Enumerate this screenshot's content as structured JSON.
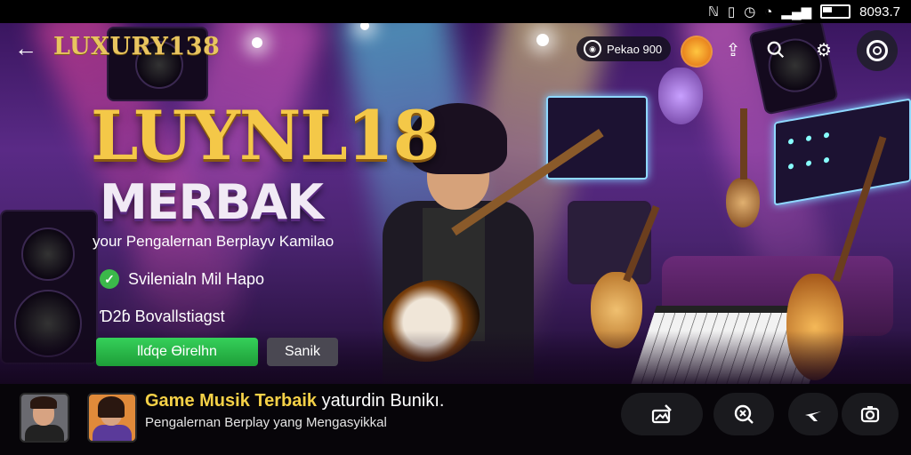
{
  "status_bar": {
    "icons": [
      "nfc-icon",
      "vibrate-icon",
      "alarm-icon",
      "wifi-icon",
      "signal-icon",
      "battery-icon"
    ],
    "clock": "8093.7"
  },
  "top_bar": {
    "brand": "LUXURY138",
    "points_label": "Pekao 900",
    "icons": [
      "back-arrow-icon",
      "coin-avatar-icon",
      "upload-icon",
      "search-icon",
      "gear-icon",
      "settings-ring-icon"
    ]
  },
  "hero": {
    "title": "LUYNL18",
    "subtitle": "MERBAK",
    "tagline": "your Pengalernan Berplayv Kamilao",
    "feature_check": "Svilenialn Mil Hapo",
    "feature_text": "Ɗ2ɓ Bovallstiagst",
    "primary_button": "Ɩlɗqe Ɵirelhn",
    "secondary_button": "Sanik"
  },
  "now_playing": {
    "title_highlight": "Game Musik Terbaik",
    "title_rest": " yaturdin Bunikı.",
    "subtitle": "Pengalernan Berplay yang Mengasyikkal",
    "controls": [
      "photo-edit-icon",
      "search-close-icon",
      "flight-icon",
      "camera-icon"
    ]
  },
  "colors": {
    "accent_gold": "#f4c848",
    "primary_green": "#2fc04f",
    "bar_bg": "#070509"
  }
}
